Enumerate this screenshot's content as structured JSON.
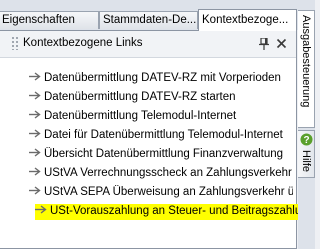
{
  "tabs": [
    {
      "label": "Eigenschaften"
    },
    {
      "label": "Stammdaten-De..."
    },
    {
      "label": "Kontextbezoge..."
    }
  ],
  "panel": {
    "title": "Kontextbezogene Links"
  },
  "links": [
    {
      "label": "Datenübermittlung DATEV-RZ mit Vorperioden"
    },
    {
      "label": "Datenübermittlung DATEV-RZ starten"
    },
    {
      "label": "Datenübermittlung Telemodul-Internet"
    },
    {
      "label": "Datei für Datenübermittlung Telemodul-Internet"
    },
    {
      "label": "Übersicht Datenübermittlung Finanzverwaltung"
    },
    {
      "label": "UStVA Verrechnungsscheck an Zahlungsverkehr ü"
    },
    {
      "label": "UStVA SEPA Überweisung an Zahlungsverkehr üb"
    },
    {
      "label": "USt-Vorauszahlung an Steuer- und Beitragszahlung",
      "highlighted": true
    }
  ],
  "side_tabs": [
    {
      "label": "Ausgabesteuerung"
    },
    {
      "label": "Hilfe",
      "icon": "help-icon"
    }
  ],
  "colors": {
    "highlight": "#ffff00",
    "arrow": "#6b6b6b",
    "help_icon": "#5aa02c"
  }
}
